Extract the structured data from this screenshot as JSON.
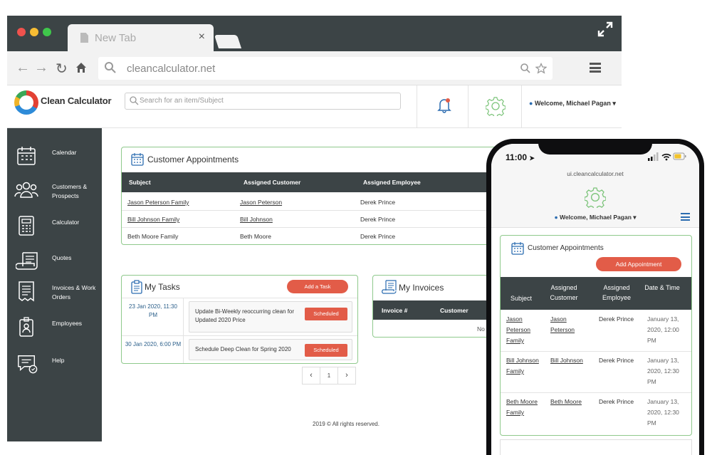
{
  "browser": {
    "tab_title": "New Tab",
    "tab_close": "×",
    "url": "cleancalculator.net"
  },
  "header": {
    "logo_text": "Clean Calculator",
    "search_placeholder": "Search for an item/Subject",
    "welcome": "Welcome, Michael Pagan"
  },
  "sidebar": {
    "items": [
      {
        "label": "Calendar",
        "icon": "calendar-icon"
      },
      {
        "label": "Customers & Prospects",
        "icon": "customers-icon"
      },
      {
        "label": "Calculator",
        "icon": "calculator-icon"
      },
      {
        "label": "Quotes",
        "icon": "quotes-icon"
      },
      {
        "label": "Invoices & Work Orders",
        "icon": "invoices-icon"
      },
      {
        "label": "Employees",
        "icon": "employees-icon"
      },
      {
        "label": "Help",
        "icon": "help-icon"
      }
    ]
  },
  "appointments": {
    "title": "Customer Appointments",
    "columns": [
      "Subject",
      "Assigned Customer",
      "Assigned Employee"
    ],
    "rows": [
      {
        "subject": "Jason Peterson Family",
        "customer": "Jason Peterson",
        "employee": "Derek Prince"
      },
      {
        "subject": "Bill Johnson Family",
        "customer": "Bill Johnson",
        "employee": "Derek Prince"
      },
      {
        "subject": "Beth Moore Family",
        "customer": "Beth Moore",
        "employee": "Derek Prince"
      }
    ]
  },
  "tasks": {
    "title": "My Tasks",
    "add_label": "Add a Task",
    "items": [
      {
        "date": "23 Jan 2020, 11:30 PM",
        "text": "Update Bi-Weekly reoccurring clean for Updated 2020 Price",
        "status": "Scheduled"
      },
      {
        "date": "30 Jan 2020, 6:00 PM",
        "text": "Schedule Deep Clean for Spring 2020",
        "status": "Scheduled"
      }
    ]
  },
  "invoices": {
    "title": "My Invoices",
    "columns": [
      "Invoice #",
      "Customer"
    ],
    "empty": "No data av"
  },
  "pagination": {
    "prev": "‹",
    "page": "1",
    "next": "›"
  },
  "footer": {
    "text": "2019 © All rights reserved."
  },
  "phone": {
    "time": "11:00",
    "url": "ui.cleancalculator.net",
    "welcome": "Welcome, Michael Pagan",
    "title": "Customer Appointments",
    "add_label": "Add Appointment",
    "columns": [
      "Subject",
      "Assigned Customer",
      "Assigned Employee",
      "Date & Time"
    ],
    "rows": [
      {
        "subject": "Jason Peterson Family",
        "customer": "Jason Peterson",
        "employee": "Derek Prince",
        "date": "January 13, 2020, 12:00 PM"
      },
      {
        "subject": "Bill Johnson Family",
        "customer": "Bill Johnson",
        "employee": "Derek Prince",
        "date": "January 13, 2020, 12:30 PM"
      },
      {
        "subject": "Beth Moore Family",
        "customer": "Beth Moore",
        "employee": "Derek Prince",
        "date": "January 13, 2020, 12:30 PM"
      }
    ]
  },
  "colors": {
    "dark": "#3c4446",
    "accent_red": "#e25c48",
    "card_border": "#8fc98c",
    "gear_green": "#7cc47a"
  }
}
